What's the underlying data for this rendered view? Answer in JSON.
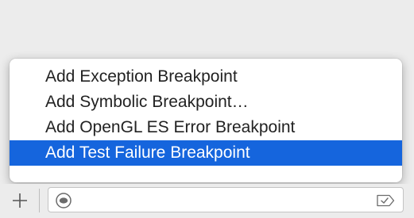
{
  "menu": {
    "items": [
      {
        "label": "Add Exception Breakpoint",
        "selected": false
      },
      {
        "label": "Add Symbolic Breakpoint…",
        "selected": false
      },
      {
        "label": "Add OpenGL ES Error Breakpoint",
        "selected": false
      },
      {
        "label": "Add Test Failure Breakpoint",
        "selected": true
      }
    ]
  },
  "bottom_bar": {
    "add_icon": "plus-icon",
    "filter": {
      "value": "",
      "placeholder": "",
      "left_icon": "filter-circle-icon",
      "right_icon": "checked-tag-icon"
    }
  },
  "colors": {
    "selection": "#1565dd",
    "background": "#ececec"
  }
}
